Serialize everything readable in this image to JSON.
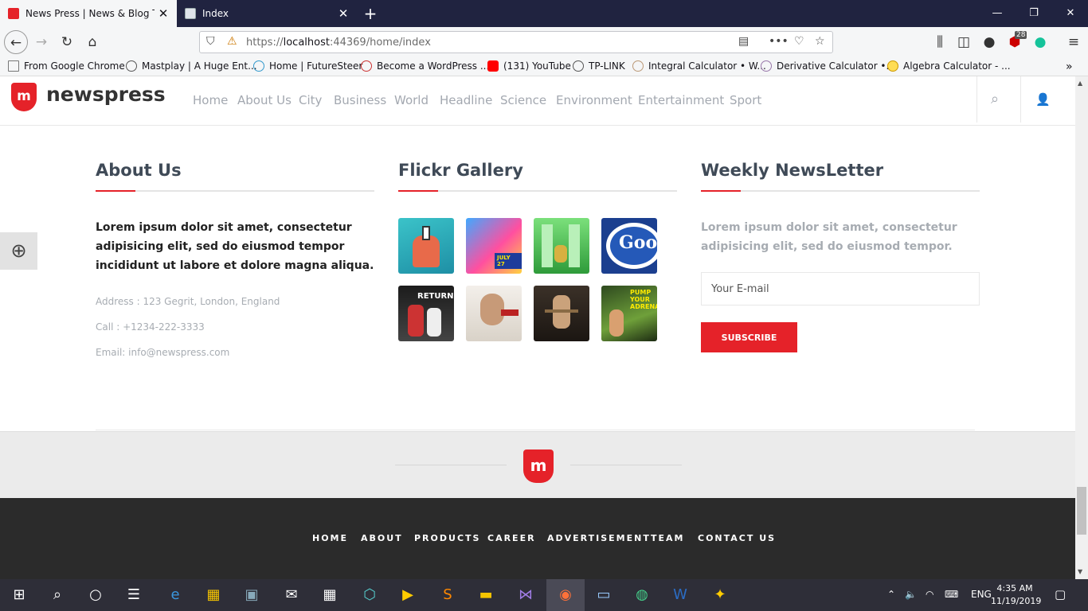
{
  "browser": {
    "tabs": [
      {
        "title": "News Press | News & Blog Temp",
        "active": true
      },
      {
        "title": "Index",
        "active": false
      }
    ],
    "url_prefix": "https://",
    "url_host": "localhost",
    "url_rest": ":44369/home/index",
    "badge_count": "28",
    "bookmarks": [
      "From Google Chrome",
      "Mastplay | A Huge Ent...",
      "Home | FutureSteer",
      "Become a WordPress ...",
      "(131) YouTube",
      "TP-LINK",
      "Integral Calculator • W...",
      "Derivative Calculator •...",
      "Algebra Calculator - ..."
    ]
  },
  "site": {
    "logo_mark": "m",
    "logo_text": "newspress",
    "menu": [
      "Home",
      "About Us",
      "City",
      "Business",
      "World",
      "Headline",
      "Science",
      "Environment",
      "Entertainment",
      "Sport"
    ]
  },
  "about": {
    "title": "About Us",
    "text": "Lorem ipsum dolor sit amet, consectetur adipisicing elit, sed do eiusmod tempor incididunt ut labore et dolore magna aliqua.",
    "address": "Address : 123 Gegrit, London, England",
    "call": "Call : +1234-222-3333",
    "email": "Email: info@newspress.com"
  },
  "gallery": {
    "title": "Flickr Gallery",
    "thumb_texts": [
      "",
      "JULY 27",
      "",
      "Goo",
      "RETURN",
      "",
      "",
      "PUMP YOUR ADRENALINE"
    ]
  },
  "newsletter": {
    "title": "Weekly NewsLetter",
    "text": "Lorem ipsum dolor sit amet, consectetur adipisicing elit, sed do eiusmod tempor.",
    "email_placeholder": "Your E-mail",
    "button": "SUBSCRIBE"
  },
  "footer_links": [
    "HOME",
    "ABOUT",
    "PRODUCTS",
    "CAREER",
    "ADVERTISEMENT",
    "TEAM",
    "CONTACT US"
  ],
  "taskbar": {
    "lang": "ENG",
    "time": "4:35 AM",
    "date": "11/19/2019"
  },
  "colors": {
    "accent": "#e52229",
    "dark_footer": "#2b2b2b",
    "titlebar": "#202340"
  }
}
